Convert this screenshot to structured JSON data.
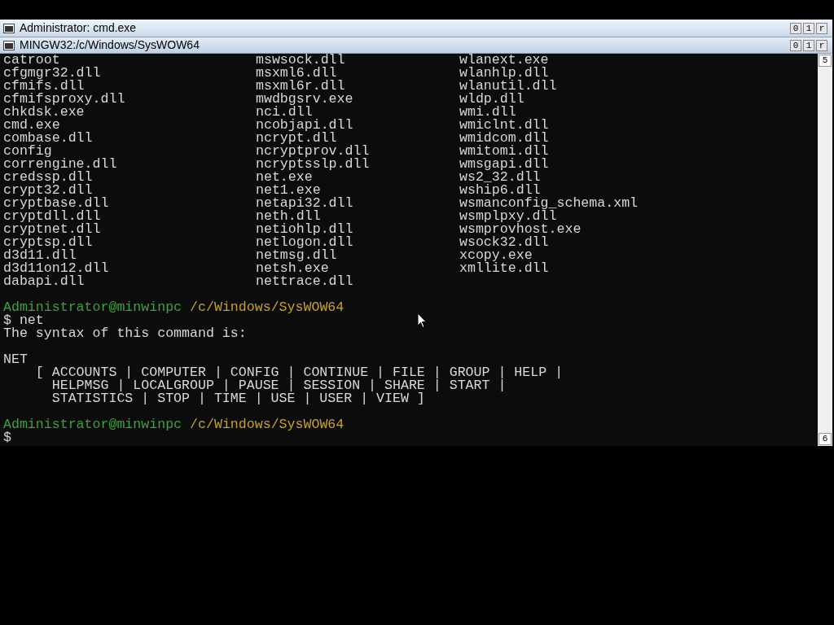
{
  "outer_window": {
    "title": "Administrator: cmd.exe",
    "buttons": [
      "0",
      "1",
      "r"
    ]
  },
  "inner_window": {
    "title": "MINGW32:/c/Windows/SysWOW64",
    "buttons": [
      "0",
      "1",
      "r"
    ]
  },
  "listing": [
    [
      "catroot",
      "mswsock.dll",
      "wlanext.exe"
    ],
    [
      "cfgmgr32.dll",
      "msxml6.dll",
      "wlanhlp.dll"
    ],
    [
      "cfmifs.dll",
      "msxml6r.dll",
      "wlanutil.dll"
    ],
    [
      "cfmifsproxy.dll",
      "mwdbgsrv.exe",
      "wldp.dll"
    ],
    [
      "chkdsk.exe",
      "nci.dll",
      "wmi.dll"
    ],
    [
      "cmd.exe",
      "ncobjapi.dll",
      "wmiclnt.dll"
    ],
    [
      "combase.dll",
      "ncrypt.dll",
      "wmidcom.dll"
    ],
    [
      "config",
      "ncryptprov.dll",
      "wmitomi.dll"
    ],
    [
      "correngine.dll",
      "ncryptsslp.dll",
      "wmsgapi.dll"
    ],
    [
      "credssp.dll",
      "net.exe",
      "ws2_32.dll"
    ],
    [
      "crypt32.dll",
      "net1.exe",
      "wship6.dll"
    ],
    [
      "cryptbase.dll",
      "netapi32.dll",
      "wsmanconfig_schema.xml"
    ],
    [
      "cryptdll.dll",
      "neth.dll",
      "wsmplpxy.dll"
    ],
    [
      "cryptnet.dll",
      "netiohlp.dll",
      "wsmprovhost.exe"
    ],
    [
      "cryptsp.dll",
      "netlogon.dll",
      "wsock32.dll"
    ],
    [
      "d3d11.dll",
      "netmsg.dll",
      "xcopy.exe"
    ],
    [
      "d3d11on12.dll",
      "netsh.exe",
      "xmllite.dll"
    ],
    [
      "dabapi.dll",
      "nettrace.dll"
    ]
  ],
  "session": [
    {
      "kind": "blank"
    },
    {
      "kind": "prompt",
      "user": "Administrator@minwinpc",
      "path": "/c/Windows/SysWOW64"
    },
    {
      "kind": "command",
      "text": "$ net"
    },
    {
      "kind": "output",
      "text": "The syntax of this command is:"
    },
    {
      "kind": "blank"
    },
    {
      "kind": "output",
      "text": "NET"
    },
    {
      "kind": "output",
      "text": "    [ ACCOUNTS | COMPUTER | CONFIG | CONTINUE | FILE | GROUP | HELP |"
    },
    {
      "kind": "output",
      "text": "      HELPMSG | LOCALGROUP | PAUSE | SESSION | SHARE | START |"
    },
    {
      "kind": "output",
      "text": "      STATISTICS | STOP | TIME | USE | USER | VIEW ]"
    },
    {
      "kind": "blank"
    },
    {
      "kind": "prompt",
      "user": "Administrator@minwinpc",
      "path": "/c/Windows/SysWOW64"
    },
    {
      "kind": "command",
      "text": "$"
    }
  ],
  "scrollbar": {
    "top_label": "5",
    "bottom_label": "6"
  }
}
